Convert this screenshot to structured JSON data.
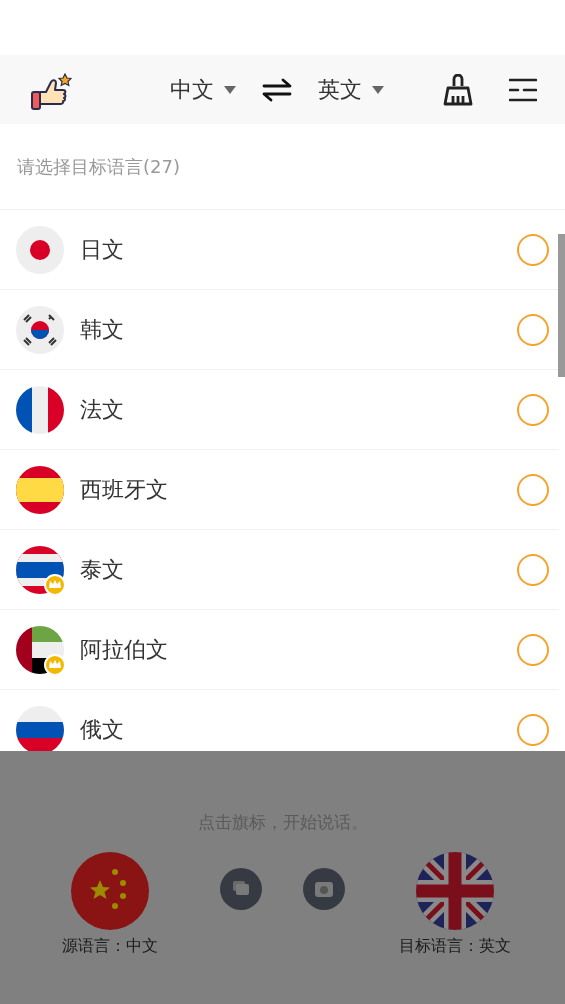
{
  "header": {
    "source_language": "中文",
    "target_language": "英文"
  },
  "list": {
    "title": "请选择目标语言(27)",
    "items": [
      {
        "name": "日文",
        "kind": "japan",
        "premium": false,
        "selected": false
      },
      {
        "name": "韩文",
        "kind": "korea",
        "premium": false,
        "selected": false
      },
      {
        "name": "法文",
        "kind": "france",
        "premium": false,
        "selected": false
      },
      {
        "name": "西班牙文",
        "kind": "spain",
        "premium": false,
        "selected": false
      },
      {
        "name": "泰文",
        "kind": "thailand",
        "premium": true,
        "selected": false
      },
      {
        "name": "阿拉伯文",
        "kind": "uae",
        "premium": true,
        "selected": false
      },
      {
        "name": "俄文",
        "kind": "russia",
        "premium": false,
        "selected": false
      }
    ]
  },
  "bottom": {
    "hint": "点击旗标，开始说话。",
    "source_label": "源语言：中文",
    "target_label": "目标语言：英文"
  }
}
